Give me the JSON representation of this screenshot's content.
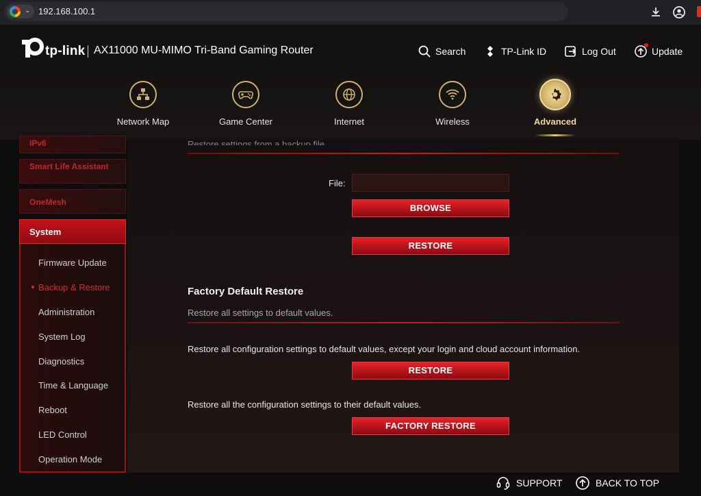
{
  "browser": {
    "url": "192.168.100.1"
  },
  "header": {
    "brand": "tp-link",
    "model": "AX11000 MU-MIMO Tri-Band Gaming Router",
    "actions": {
      "search": "Search",
      "tplink_id": "TP-Link ID",
      "logout": "Log Out",
      "update": "Update"
    }
  },
  "nav": {
    "tabs": [
      {
        "label": "Network Map",
        "icon": "network-map-icon"
      },
      {
        "label": "Game Center",
        "icon": "gamepad-icon"
      },
      {
        "label": "Internet",
        "icon": "globe-icon"
      },
      {
        "label": "Wireless",
        "icon": "wifi-icon"
      },
      {
        "label": "Advanced",
        "icon": "gear-icon"
      }
    ],
    "active": "Advanced"
  },
  "sidebar": {
    "groups": [
      "IPv6",
      "Smart Life Assistant",
      "OneMesh"
    ],
    "section": "System",
    "items": [
      "Firmware Update",
      "Backup & Restore",
      "Administration",
      "System Log",
      "Diagnostics",
      "Time & Language",
      "Reboot",
      "LED Control",
      "Operation Mode"
    ],
    "active_item": "Backup & Restore"
  },
  "restore": {
    "partial_description": "Restore settings from a backup file.",
    "file_label": "File:",
    "file_value": "",
    "browse_button": "BROWSE",
    "restore_button": "RESTORE"
  },
  "factory": {
    "title": "Factory Default Restore",
    "subtitle": "Restore all settings to default values.",
    "desc1": "Restore all configuration settings to default values, except your login and cloud account information.",
    "restore_button": "RESTORE",
    "desc2": "Restore all the configuration settings to their default values.",
    "factory_button": "FACTORY RESTORE"
  },
  "footer": {
    "support": "SUPPORT",
    "back_to_top": "BACK TO TOP"
  },
  "colors": {
    "accent_red": "#d21a1a",
    "gold": "#d1b36c",
    "background": "#0e0c0c"
  }
}
